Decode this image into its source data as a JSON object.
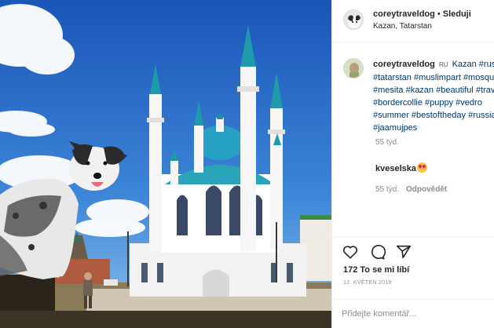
{
  "header": {
    "username": "coreytraveldog",
    "separator": "•",
    "follow_label": "Sleduji",
    "location": "Kazan, Tatarstan"
  },
  "caption": {
    "username": "coreytraveldog",
    "flag": "RU",
    "lines": [
      "Kazan #russia",
      "#tatarstan #muslimpart #mosque",
      "#mesita #kazan #beautiful #travel",
      "#bordercollie #puppy #vedro",
      "#summer #bestoftheday #russia",
      "#jaamujpes"
    ],
    "time": "55 týd."
  },
  "comment": {
    "username": "kveselska",
    "emoji": "heart-eyes",
    "time": "55 týd.",
    "reply_label": "Odpovědět"
  },
  "actions": {
    "like_icon": "heart-icon",
    "comment_icon": "speech-bubble-icon",
    "share_icon": "paper-plane-icon"
  },
  "likes": "172 To se mi líbí",
  "date": "12. KVĚTEN 2019",
  "comment_input": {
    "placeholder": "Přidejte komentář..."
  },
  "colors": {
    "sky": "#1f63c9",
    "dome": "#2aa4b8",
    "link": "#00376b",
    "muted": "#8e8e8e"
  }
}
